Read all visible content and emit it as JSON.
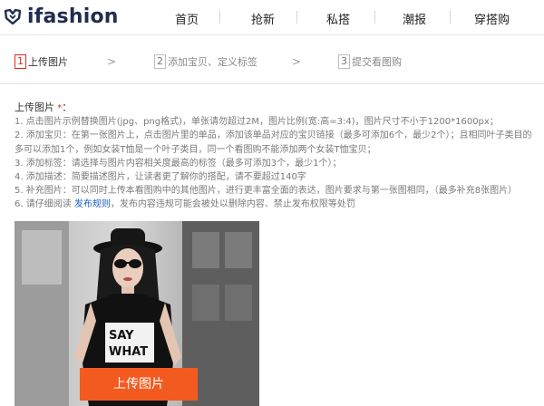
{
  "brand": {
    "logo_text": "ifashion"
  },
  "nav": {
    "items": [
      "首页",
      "抢新",
      "私搭",
      "潮报",
      "穿搭购"
    ]
  },
  "steps": [
    {
      "num": "1",
      "label": "上传图片"
    },
    {
      "num": "2",
      "label": "添加宝贝、定义标签"
    },
    {
      "num": "3",
      "label": "提交看图购"
    }
  ],
  "step_arrow": ">",
  "instructions": {
    "title": "上传图片",
    "required_mark": "*",
    "title_suffix": "：",
    "lines": [
      "1. 点击图片示例替换图片(jpg、png格式)，单张请勿超过2M，图片比例(宽:高=3:4)，图片尺寸不小于1200*1600px；",
      "2. 添加宝贝：在第一张图片上，点击图片里的单品，添加该单品对应的宝贝链接（最多可添加6个，最少2个）；且相同叶子类目的",
      "多可以添加1个，例如女装T恤是一个叶子类目，同一个看图购不能添加两个女装T恤宝贝；",
      "3. 添加标签：请选择与图片内容相关度最高的标签（最多可添加3个，最少1个）；",
      "4. 添加描述：简要描述图片，让读者更了解你的搭配，请不要超过140字",
      "5. 补充图片：可以同时上传本看图购中的其他图片，进行更丰富全面的表达，图片要求与第一张图相同，（最多补充8张图片）"
    ],
    "last_line_prefix": "6. 请仔细阅读 ",
    "last_line_link": "发布规则",
    "last_line_suffix": "，发布内容违规可能会被处以删除内容、禁止发布权限等处罚"
  },
  "photo": {
    "shirt_text_1": "SAY",
    "shirt_text_2": "WHAT"
  },
  "upload_button": {
    "label": "上传图片"
  },
  "colors": {
    "accent": "#f35a1f",
    "step_active": "#e02a1a",
    "link": "#1f5fc2",
    "logo": "#1f2d4d"
  }
}
